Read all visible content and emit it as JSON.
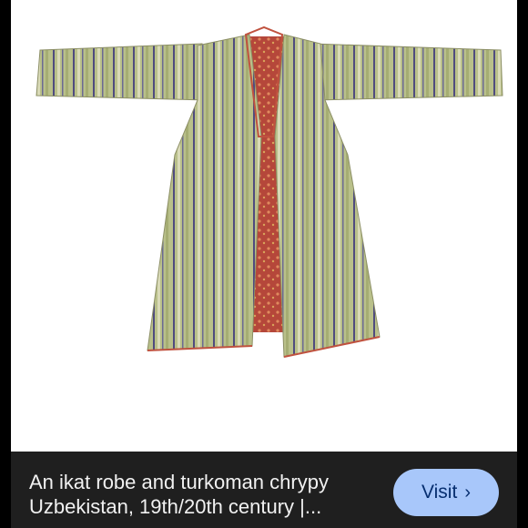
{
  "image": {
    "subject": "robe-photo",
    "colors": {
      "background": "#ffffff",
      "robe_green": "#b8bf86",
      "stripe_purple": "#4d4a7e",
      "lining_red": "#b84a3c"
    }
  },
  "caption": {
    "line1": "An ikat robe and turkoman chrypy",
    "line2": "Uzbekistan, 19th/20th century |..."
  },
  "visit_button": {
    "label": "Visit",
    "icon": "chevron-right-icon",
    "color": "#a8c7fa"
  }
}
